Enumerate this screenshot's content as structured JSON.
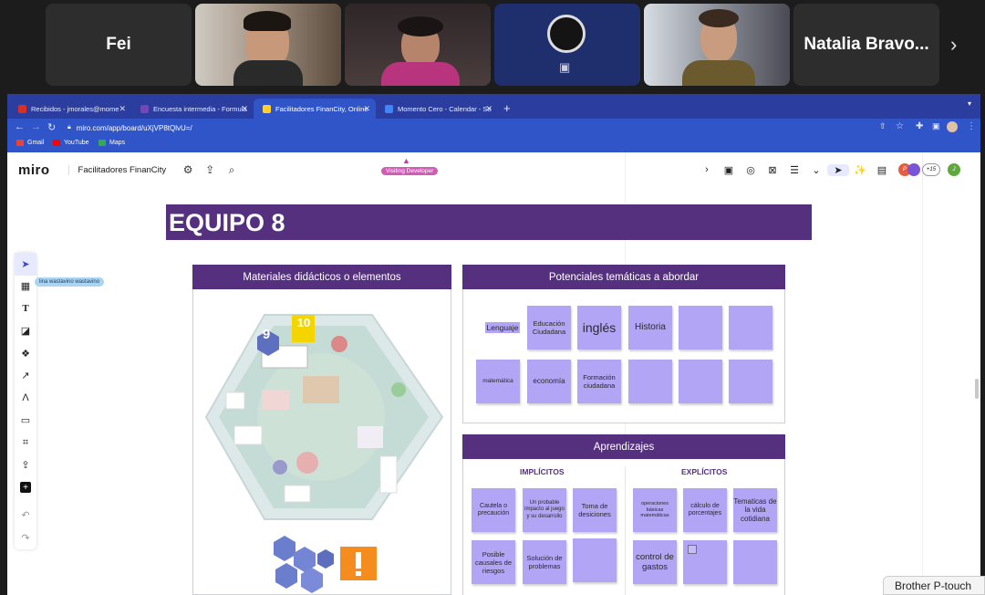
{
  "meeting": {
    "participants": [
      {
        "name": "Fei",
        "type": "name"
      },
      {
        "name": "",
        "type": "video"
      },
      {
        "name": "",
        "type": "video"
      },
      {
        "name": "",
        "type": "camera-off"
      },
      {
        "name": "",
        "type": "video"
      },
      {
        "name": "Natalia Bravo...",
        "type": "name"
      }
    ]
  },
  "browser": {
    "tabs": [
      {
        "label": "Recibidos - jmorales@mome",
        "favicon_color": "#d93025"
      },
      {
        "label": "Encuesta intermedia - Formula",
        "favicon_color": "#7248b9"
      },
      {
        "label": "Facilitadores FinanCity, Online",
        "favicon_color": "#ffd02f",
        "active": true
      },
      {
        "label": "Momento Cero - Calendar - Se",
        "favicon_color": "#4285f4"
      }
    ],
    "new_tab": "+",
    "url": "miro.com/app/board/uXjVP8tQlvU=/",
    "bookmarks": [
      {
        "label": "Gmail",
        "color": "#ea4335"
      },
      {
        "label": "YouTube",
        "color": "#ff0000"
      },
      {
        "label": "Maps",
        "color": "#34a853"
      }
    ]
  },
  "miro": {
    "logo": "miro",
    "board_name": "Facilitadores FinanCity",
    "visiting_tag": "Visiting Developer",
    "collaborator_count": "+15",
    "avatar_initial": "J",
    "cursor_label": "lina wastavino wastavino"
  },
  "board": {
    "team_title": "EQUIPO 8",
    "materials_title": "Materiales didácticos o elementos",
    "topics_title": "Potenciales temáticas a abordar",
    "topics": [
      "Lenguaje",
      "Educación Ciudadana",
      "inglés",
      "Historia",
      "",
      "",
      "matemática",
      "economía",
      "Formación ciudadana",
      "",
      "",
      ""
    ],
    "learning_title": "Aprendizajes",
    "implicit_title": "IMPLÍCITOS",
    "explicit_title": "EXPLÍCITOS",
    "implicit": [
      "Cautela o precaución",
      "Un probable impacto al juego y su desarrollo",
      "Toma de desiciones",
      "Posible causales de riesgos",
      "Solución de problemas",
      ""
    ],
    "explicit": [
      "operaciones básicas matemáticas",
      "cálculo de porcentajes",
      "Tematicas de la vida cotidiana",
      "control de gastos",
      "",
      ""
    ],
    "map_badge_1": "9",
    "map_badge_2": "10"
  },
  "taskbar_hint": "Brother P-touch"
}
